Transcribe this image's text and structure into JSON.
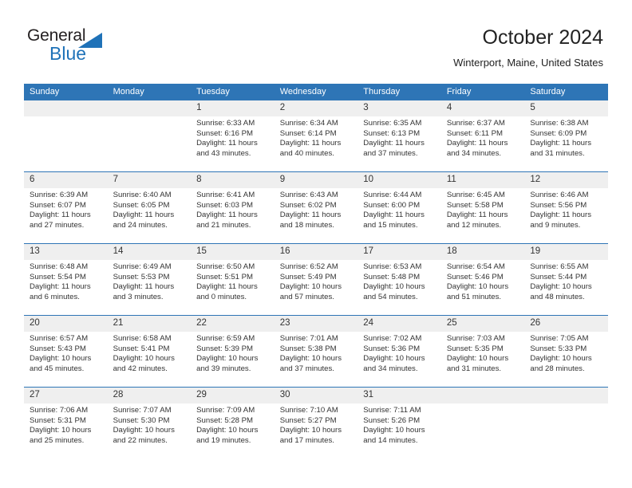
{
  "brand": {
    "name_part1": "General",
    "name_part2": "Blue",
    "triangle_color": "#1f72b8"
  },
  "header": {
    "title": "October 2024",
    "location": "Winterport, Maine, United States"
  },
  "theme": {
    "header_blue": "#2e75b6",
    "daynum_band": "#efefef",
    "text": "#333333"
  },
  "calendar": {
    "weekday_headers": [
      "Sunday",
      "Monday",
      "Tuesday",
      "Wednesday",
      "Thursday",
      "Friday",
      "Saturday"
    ],
    "weeks": [
      [
        {
          "day": "",
          "blank": true
        },
        {
          "day": "",
          "blank": true
        },
        {
          "day": "1",
          "sunrise": "Sunrise: 6:33 AM",
          "sunset": "Sunset: 6:16 PM",
          "daylight_1": "Daylight: 11 hours",
          "daylight_2": "and 43 minutes."
        },
        {
          "day": "2",
          "sunrise": "Sunrise: 6:34 AM",
          "sunset": "Sunset: 6:14 PM",
          "daylight_1": "Daylight: 11 hours",
          "daylight_2": "and 40 minutes."
        },
        {
          "day": "3",
          "sunrise": "Sunrise: 6:35 AM",
          "sunset": "Sunset: 6:13 PM",
          "daylight_1": "Daylight: 11 hours",
          "daylight_2": "and 37 minutes."
        },
        {
          "day": "4",
          "sunrise": "Sunrise: 6:37 AM",
          "sunset": "Sunset: 6:11 PM",
          "daylight_1": "Daylight: 11 hours",
          "daylight_2": "and 34 minutes."
        },
        {
          "day": "5",
          "sunrise": "Sunrise: 6:38 AM",
          "sunset": "Sunset: 6:09 PM",
          "daylight_1": "Daylight: 11 hours",
          "daylight_2": "and 31 minutes."
        }
      ],
      [
        {
          "day": "6",
          "sunrise": "Sunrise: 6:39 AM",
          "sunset": "Sunset: 6:07 PM",
          "daylight_1": "Daylight: 11 hours",
          "daylight_2": "and 27 minutes."
        },
        {
          "day": "7",
          "sunrise": "Sunrise: 6:40 AM",
          "sunset": "Sunset: 6:05 PM",
          "daylight_1": "Daylight: 11 hours",
          "daylight_2": "and 24 minutes."
        },
        {
          "day": "8",
          "sunrise": "Sunrise: 6:41 AM",
          "sunset": "Sunset: 6:03 PM",
          "daylight_1": "Daylight: 11 hours",
          "daylight_2": "and 21 minutes."
        },
        {
          "day": "9",
          "sunrise": "Sunrise: 6:43 AM",
          "sunset": "Sunset: 6:02 PM",
          "daylight_1": "Daylight: 11 hours",
          "daylight_2": "and 18 minutes."
        },
        {
          "day": "10",
          "sunrise": "Sunrise: 6:44 AM",
          "sunset": "Sunset: 6:00 PM",
          "daylight_1": "Daylight: 11 hours",
          "daylight_2": "and 15 minutes."
        },
        {
          "day": "11",
          "sunrise": "Sunrise: 6:45 AM",
          "sunset": "Sunset: 5:58 PM",
          "daylight_1": "Daylight: 11 hours",
          "daylight_2": "and 12 minutes."
        },
        {
          "day": "12",
          "sunrise": "Sunrise: 6:46 AM",
          "sunset": "Sunset: 5:56 PM",
          "daylight_1": "Daylight: 11 hours",
          "daylight_2": "and 9 minutes."
        }
      ],
      [
        {
          "day": "13",
          "sunrise": "Sunrise: 6:48 AM",
          "sunset": "Sunset: 5:54 PM",
          "daylight_1": "Daylight: 11 hours",
          "daylight_2": "and 6 minutes."
        },
        {
          "day": "14",
          "sunrise": "Sunrise: 6:49 AM",
          "sunset": "Sunset: 5:53 PM",
          "daylight_1": "Daylight: 11 hours",
          "daylight_2": "and 3 minutes."
        },
        {
          "day": "15",
          "sunrise": "Sunrise: 6:50 AM",
          "sunset": "Sunset: 5:51 PM",
          "daylight_1": "Daylight: 11 hours",
          "daylight_2": "and 0 minutes."
        },
        {
          "day": "16",
          "sunrise": "Sunrise: 6:52 AM",
          "sunset": "Sunset: 5:49 PM",
          "daylight_1": "Daylight: 10 hours",
          "daylight_2": "and 57 minutes."
        },
        {
          "day": "17",
          "sunrise": "Sunrise: 6:53 AM",
          "sunset": "Sunset: 5:48 PM",
          "daylight_1": "Daylight: 10 hours",
          "daylight_2": "and 54 minutes."
        },
        {
          "day": "18",
          "sunrise": "Sunrise: 6:54 AM",
          "sunset": "Sunset: 5:46 PM",
          "daylight_1": "Daylight: 10 hours",
          "daylight_2": "and 51 minutes."
        },
        {
          "day": "19",
          "sunrise": "Sunrise: 6:55 AM",
          "sunset": "Sunset: 5:44 PM",
          "daylight_1": "Daylight: 10 hours",
          "daylight_2": "and 48 minutes."
        }
      ],
      [
        {
          "day": "20",
          "sunrise": "Sunrise: 6:57 AM",
          "sunset": "Sunset: 5:43 PM",
          "daylight_1": "Daylight: 10 hours",
          "daylight_2": "and 45 minutes."
        },
        {
          "day": "21",
          "sunrise": "Sunrise: 6:58 AM",
          "sunset": "Sunset: 5:41 PM",
          "daylight_1": "Daylight: 10 hours",
          "daylight_2": "and 42 minutes."
        },
        {
          "day": "22",
          "sunrise": "Sunrise: 6:59 AM",
          "sunset": "Sunset: 5:39 PM",
          "daylight_1": "Daylight: 10 hours",
          "daylight_2": "and 39 minutes."
        },
        {
          "day": "23",
          "sunrise": "Sunrise: 7:01 AM",
          "sunset": "Sunset: 5:38 PM",
          "daylight_1": "Daylight: 10 hours",
          "daylight_2": "and 37 minutes."
        },
        {
          "day": "24",
          "sunrise": "Sunrise: 7:02 AM",
          "sunset": "Sunset: 5:36 PM",
          "daylight_1": "Daylight: 10 hours",
          "daylight_2": "and 34 minutes."
        },
        {
          "day": "25",
          "sunrise": "Sunrise: 7:03 AM",
          "sunset": "Sunset: 5:35 PM",
          "daylight_1": "Daylight: 10 hours",
          "daylight_2": "and 31 minutes."
        },
        {
          "day": "26",
          "sunrise": "Sunrise: 7:05 AM",
          "sunset": "Sunset: 5:33 PM",
          "daylight_1": "Daylight: 10 hours",
          "daylight_2": "and 28 minutes."
        }
      ],
      [
        {
          "day": "27",
          "sunrise": "Sunrise: 7:06 AM",
          "sunset": "Sunset: 5:31 PM",
          "daylight_1": "Daylight: 10 hours",
          "daylight_2": "and 25 minutes."
        },
        {
          "day": "28",
          "sunrise": "Sunrise: 7:07 AM",
          "sunset": "Sunset: 5:30 PM",
          "daylight_1": "Daylight: 10 hours",
          "daylight_2": "and 22 minutes."
        },
        {
          "day": "29",
          "sunrise": "Sunrise: 7:09 AM",
          "sunset": "Sunset: 5:28 PM",
          "daylight_1": "Daylight: 10 hours",
          "daylight_2": "and 19 minutes."
        },
        {
          "day": "30",
          "sunrise": "Sunrise: 7:10 AM",
          "sunset": "Sunset: 5:27 PM",
          "daylight_1": "Daylight: 10 hours",
          "daylight_2": "and 17 minutes."
        },
        {
          "day": "31",
          "sunrise": "Sunrise: 7:11 AM",
          "sunset": "Sunset: 5:26 PM",
          "daylight_1": "Daylight: 10 hours",
          "daylight_2": "and 14 minutes."
        },
        {
          "day": "",
          "blank": true
        },
        {
          "day": "",
          "blank": true
        }
      ]
    ]
  }
}
